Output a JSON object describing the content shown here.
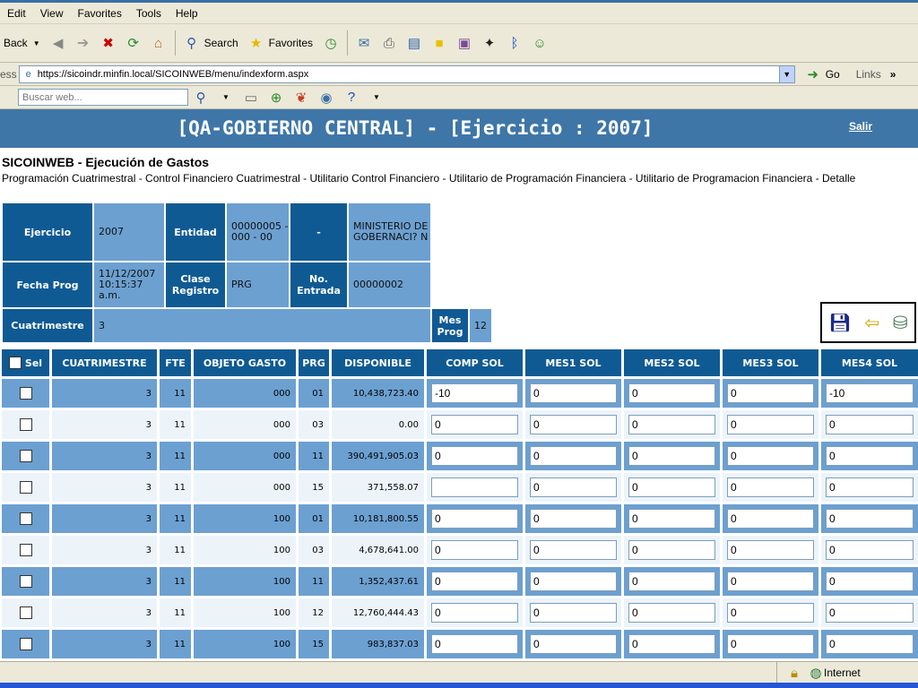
{
  "browser": {
    "menu": [
      "Edit",
      "View",
      "Favorites",
      "Tools",
      "Help"
    ],
    "toolbar": {
      "back_label": "Back",
      "search_label": "Search",
      "favorites_label": "Favorites"
    },
    "address": {
      "label_fragment": "ess",
      "url": "https://sicoindr.minfin.local/SICOINWEB/menu/indexform.aspx",
      "go_label": "Go",
      "links_label": "Links"
    },
    "search_bar": {
      "placeholder": "Buscar web..."
    },
    "status": {
      "zone": "Internet"
    }
  },
  "banner": {
    "title": "[QA-GOBIERNO CENTRAL] - [Ejercicio : 2007]",
    "salir": "Salir"
  },
  "page": {
    "heading": "SICOINWEB - Ejecución de Gastos",
    "breadcrumb": "Programación Cuatrimestral - Control Financiero Cuatrimestral - Utilitario Control Financiero - Utilitario de Programación Financiera - Utilitario de Programacion Financiera - Detalle"
  },
  "info": {
    "ejercicio_label": "Ejercicio",
    "ejercicio": "2007",
    "entidad_label": "Entidad",
    "entidad": "00000005 - 000 - 00",
    "dash": "-",
    "ministerio": "MINISTERIO DE GOBERNACI? N",
    "fecha_label": "Fecha Prog",
    "fecha": "11/12/2007 10:15:37 a.m.",
    "clase_label": "Clase Registro",
    "clase": "PRG",
    "entrada_label": "No. Entrada",
    "entrada": "00000002",
    "cuatri_label": "Cuatrimestre",
    "cuatri": "3",
    "mesprog_label": "Mes Prog",
    "mesprog": "12"
  },
  "table": {
    "headers": [
      "Sel",
      "CUATRIMESTRE",
      "FTE",
      "OBJETO GASTO",
      "PRG",
      "DISPONIBLE",
      "COMP SOL",
      "MES1 SOL",
      "MES2 SOL",
      "MES3 SOL",
      "MES4 SOL"
    ],
    "rows": [
      {
        "cuatrimestre": "3",
        "fte": "11",
        "objeto": "000",
        "prg": "01",
        "disponible": "10,438,723.40",
        "comp": "-10",
        "mes1": "0",
        "mes2": "0",
        "mes3": "0",
        "mes4": "-10"
      },
      {
        "cuatrimestre": "3",
        "fte": "11",
        "objeto": "000",
        "prg": "03",
        "disponible": "0.00",
        "comp": "0",
        "mes1": "0",
        "mes2": "0",
        "mes3": "0",
        "mes4": "0"
      },
      {
        "cuatrimestre": "3",
        "fte": "11",
        "objeto": "000",
        "prg": "11",
        "disponible": "390,491,905.03",
        "comp": "0",
        "mes1": "0",
        "mes2": "0",
        "mes3": "0",
        "mes4": "0"
      },
      {
        "cuatrimestre": "3",
        "fte": "11",
        "objeto": "000",
        "prg": "15",
        "disponible": "371,558.07",
        "comp": "",
        "mes1": "0",
        "mes2": "0",
        "mes3": "0",
        "mes4": "0"
      },
      {
        "cuatrimestre": "3",
        "fte": "11",
        "objeto": "100",
        "prg": "01",
        "disponible": "10,181,800.55",
        "comp": "0",
        "mes1": "0",
        "mes2": "0",
        "mes3": "0",
        "mes4": "0"
      },
      {
        "cuatrimestre": "3",
        "fte": "11",
        "objeto": "100",
        "prg": "03",
        "disponible": "4,678,641.00",
        "comp": "0",
        "mes1": "0",
        "mes2": "0",
        "mes3": "0",
        "mes4": "0"
      },
      {
        "cuatrimestre": "3",
        "fte": "11",
        "objeto": "100",
        "prg": "11",
        "disponible": "1,352,437.61",
        "comp": "0",
        "mes1": "0",
        "mes2": "0",
        "mes3": "0",
        "mes4": "0"
      },
      {
        "cuatrimestre": "3",
        "fte": "11",
        "objeto": "100",
        "prg": "12",
        "disponible": "12,760,444.43",
        "comp": "0",
        "mes1": "0",
        "mes2": "0",
        "mes3": "0",
        "mes4": "0"
      },
      {
        "cuatrimestre": "3",
        "fte": "11",
        "objeto": "100",
        "prg": "15",
        "disponible": "983,837.03",
        "comp": "0",
        "mes1": "0",
        "mes2": "0",
        "mes3": "0",
        "mes4": "0"
      }
    ]
  },
  "colors": {
    "header_blue": "#105a93",
    "band_blue": "#6ca0d1",
    "row_alt": "#ecf4fa",
    "banner": "#3f76a8"
  }
}
